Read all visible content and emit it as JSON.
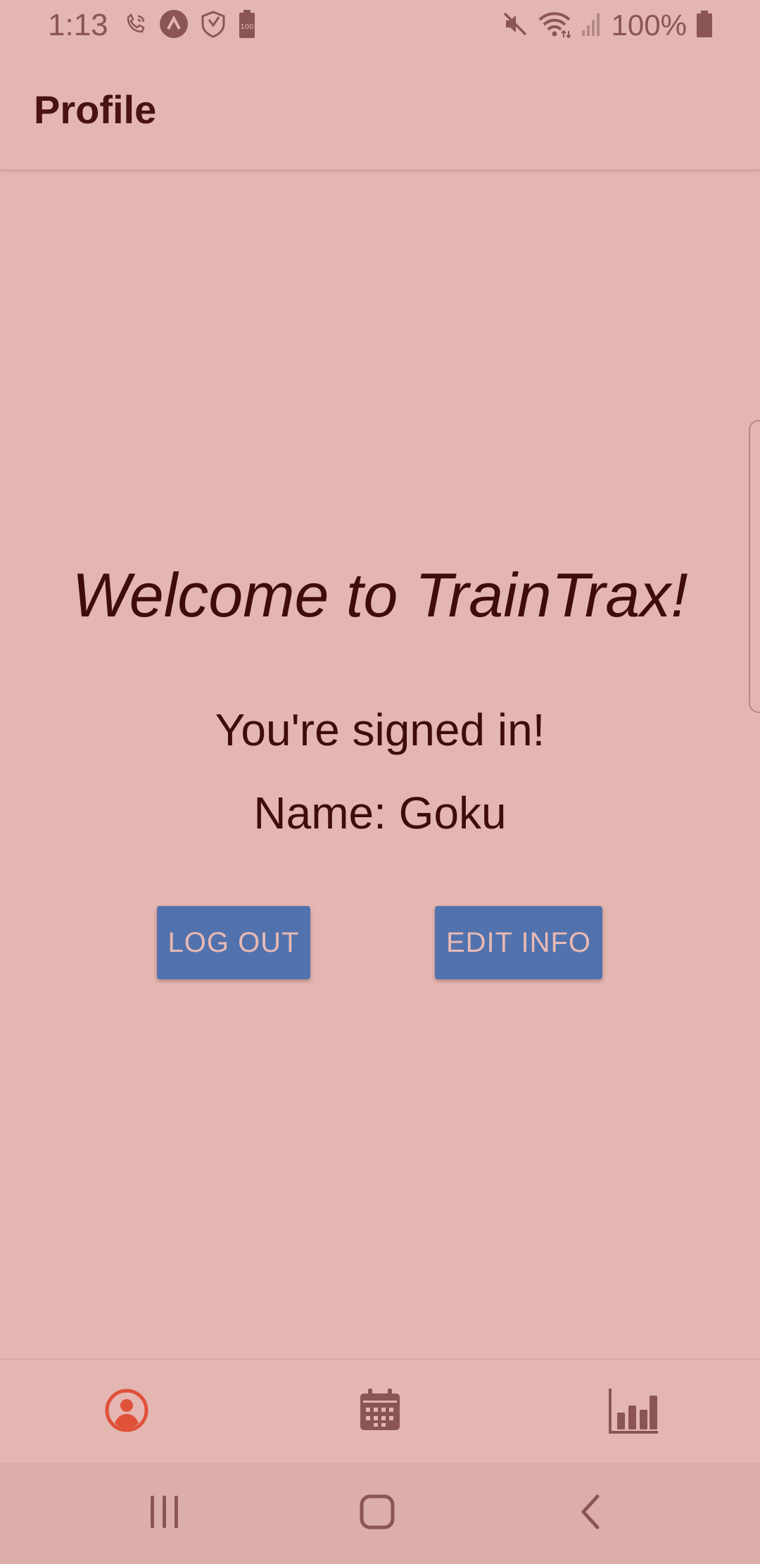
{
  "status_bar": {
    "time": "1:13",
    "battery_text": "100%",
    "left_icons": [
      "wifi-call-icon",
      "app-a-icon",
      "shield-icon",
      "battery-saver-icon"
    ],
    "right_icons": [
      "mute-icon",
      "wifi-icon",
      "signal-icon",
      "battery-icon"
    ]
  },
  "app_bar": {
    "title": "Profile"
  },
  "main": {
    "welcome": "Welcome to TrainTrax!",
    "signed_in": "You're signed in!",
    "name_line": "Name: Goku",
    "logout_label": "LOG OUT",
    "edit_label": "EDIT INFO"
  },
  "tab_bar": {
    "tabs": [
      {
        "icon": "profile-icon",
        "active": true
      },
      {
        "icon": "calendar-icon",
        "active": false
      },
      {
        "icon": "bar-chart-icon",
        "active": false
      }
    ]
  },
  "colors": {
    "background": "#e4b6b1",
    "text_dark": "#3f0b0b",
    "button": "#5272ad",
    "button_text": "#e8b9b4",
    "active_tab": "#e0513a",
    "inactive_tab": "#8a5552"
  }
}
